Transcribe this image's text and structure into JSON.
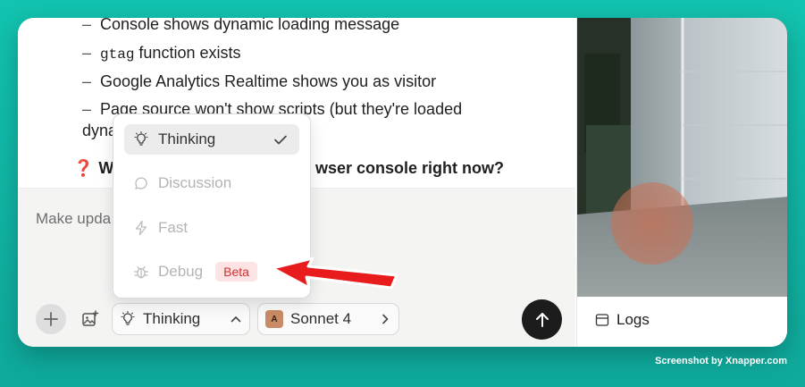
{
  "transcript": {
    "bullets": [
      {
        "text": "Console shows dynamic loading message"
      },
      {
        "code": "gtag",
        "text": " function exists"
      },
      {
        "text": "Google Analytics Realtime shows you as visitor"
      },
      {
        "text": "Page source won't show scripts (but they're loaded"
      }
    ],
    "dash": "–",
    "continuation_start": "dyna",
    "question_mark": "❓",
    "question_start": "Wh",
    "question_end": "wser console right now?"
  },
  "composer": {
    "input_text": "Make upda",
    "mode_label": "Thinking",
    "model_label": "Sonnet 4",
    "model_logo_text": "A"
  },
  "menu": {
    "items": [
      {
        "label": "Thinking",
        "state": "selected",
        "icon": "lightbulb-icon"
      },
      {
        "label": "Discussion",
        "state": "disabled",
        "icon": "chat-bubble-icon"
      },
      {
        "label": "Fast",
        "state": "disabled",
        "icon": "lightning-icon"
      },
      {
        "label": "Debug",
        "state": "disabled",
        "icon": "bug-icon",
        "badge": "Beta"
      }
    ]
  },
  "side": {
    "logs_label": "Logs"
  },
  "footer": "Screenshot by Xnapper.com",
  "colors": {
    "background": "#12c4b0",
    "send_button": "#1c1c1c",
    "beta_badge": "#fde3e3",
    "beta_text": "#d4312e",
    "annotation_arrow": "#e81c1c"
  }
}
